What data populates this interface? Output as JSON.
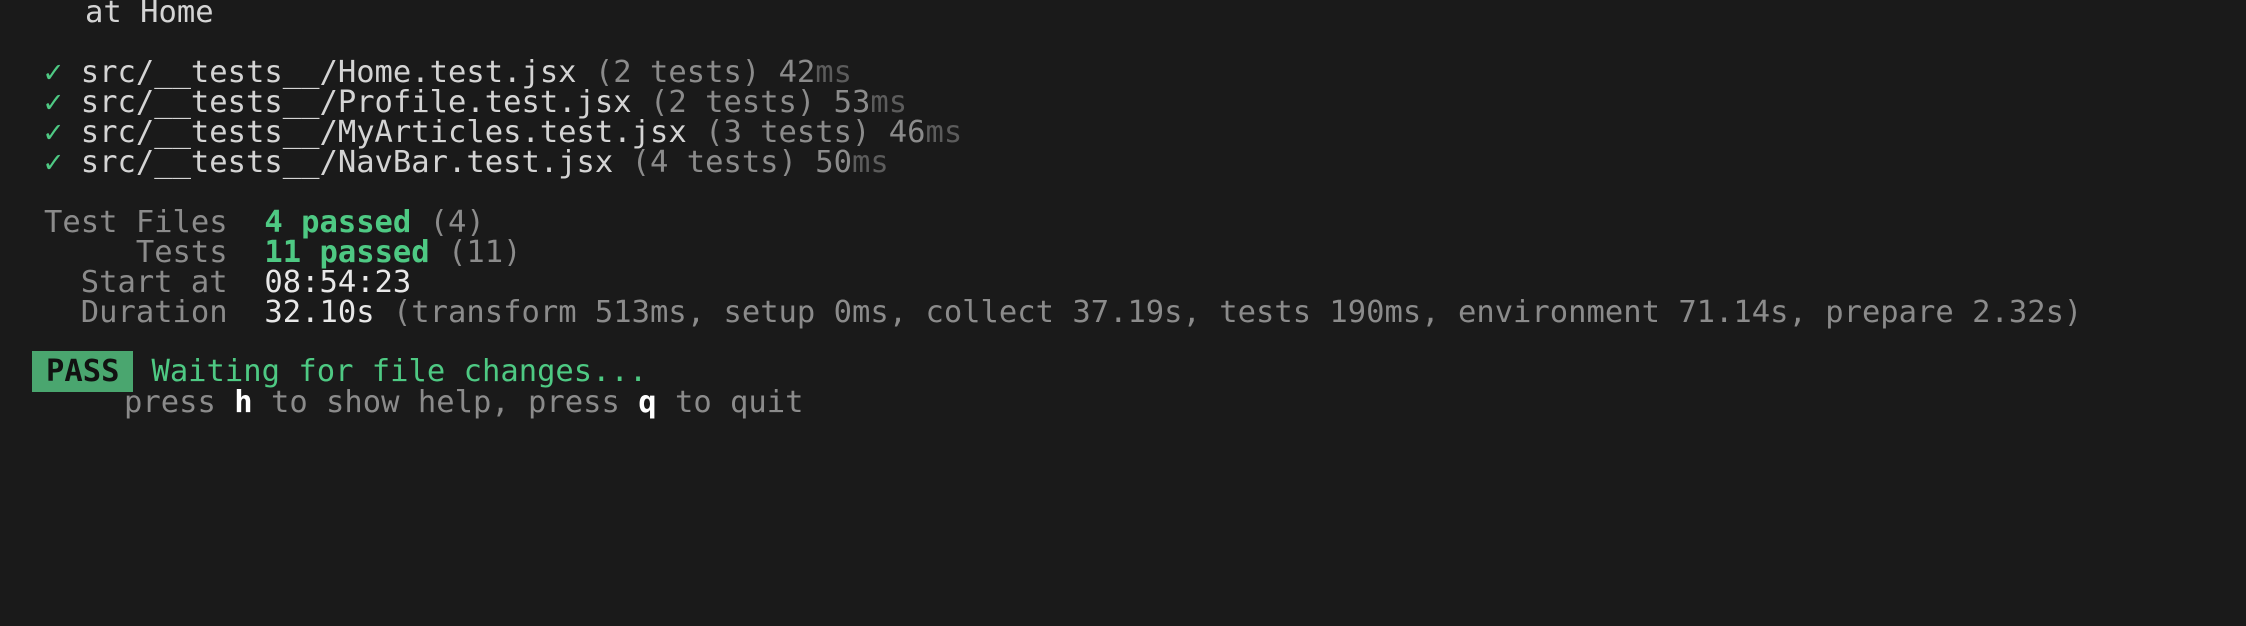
{
  "trace": {
    "prefix": "at",
    "name": "Home"
  },
  "results": [
    {
      "mark": "✓",
      "file": "src/__tests__/Home.test.jsx",
      "count": "(2 tests)",
      "time_num": "42",
      "time_unit": "ms"
    },
    {
      "mark": "✓",
      "file": "src/__tests__/Profile.test.jsx",
      "count": "(2 tests)",
      "time_num": "53",
      "time_unit": "ms"
    },
    {
      "mark": "✓",
      "file": "src/__tests__/MyArticles.test.jsx",
      "count": "(3 tests)",
      "time_num": "46",
      "time_unit": "ms"
    },
    {
      "mark": "✓",
      "file": "src/__tests__/NavBar.test.jsx",
      "count": "(4 tests)",
      "time_num": "50",
      "time_unit": "ms"
    }
  ],
  "summary": {
    "test_files": {
      "label": "Test Files",
      "value": "4 passed",
      "total": "(4)"
    },
    "tests": {
      "label": "Tests",
      "value": "11 passed",
      "total": "(11)"
    },
    "start_at": {
      "label": "Start at",
      "value": "08:54:23"
    },
    "duration": {
      "label": "Duration",
      "value": "32.10s",
      "detail": "(transform 513ms, setup 0ms, collect 37.19s, tests 190ms, environment 71.14s, prepare 2.32s)"
    }
  },
  "status": {
    "badge": "PASS",
    "message": "Waiting for file changes...",
    "hint": {
      "press1": "press",
      "key_help": "h",
      "help_text": "to show help, press",
      "key_quit": "q",
      "quit_text": "to quit"
    }
  },
  "colors": {
    "background": "#1a1a1a",
    "green": "#4ec983",
    "badge": "#4aa66f",
    "dim": "#8b8b8b"
  }
}
